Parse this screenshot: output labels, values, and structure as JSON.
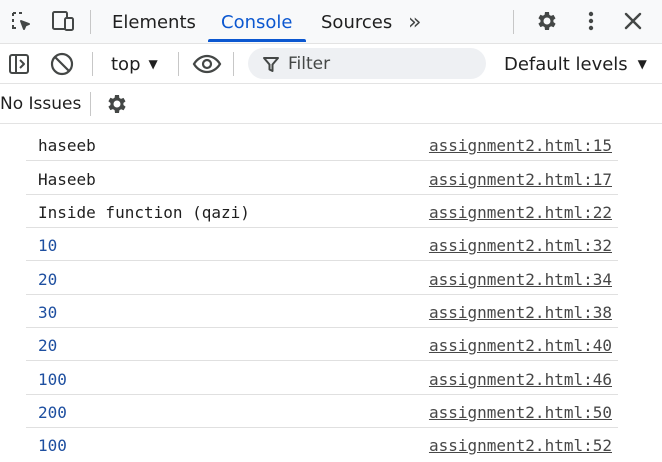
{
  "tabs": {
    "elements": "Elements",
    "console": "Console",
    "sources": "Sources",
    "more": "»"
  },
  "toolbar": {
    "context": "top",
    "filter_placeholder": "Filter",
    "levels": "Default levels"
  },
  "issues": {
    "label": "No Issues"
  },
  "messages": [
    {
      "text": "haseeb",
      "type": "string",
      "source": "assignment2.html:15"
    },
    {
      "text": "Haseeb",
      "type": "string",
      "source": "assignment2.html:17"
    },
    {
      "text": "Inside function (qazi)",
      "type": "string",
      "source": "assignment2.html:22"
    },
    {
      "text": "10",
      "type": "number",
      "source": "assignment2.html:32"
    },
    {
      "text": "20",
      "type": "number",
      "source": "assignment2.html:34"
    },
    {
      "text": "30",
      "type": "number",
      "source": "assignment2.html:38"
    },
    {
      "text": "20",
      "type": "number",
      "source": "assignment2.html:40"
    },
    {
      "text": "100",
      "type": "number",
      "source": "assignment2.html:46"
    },
    {
      "text": "200",
      "type": "number",
      "source": "assignment2.html:50"
    },
    {
      "text": "100",
      "type": "number",
      "source": "assignment2.html:52"
    }
  ],
  "colors": {
    "accent": "#0b57d0",
    "number_text": "#1e4fa0",
    "link_text": "#474747"
  }
}
